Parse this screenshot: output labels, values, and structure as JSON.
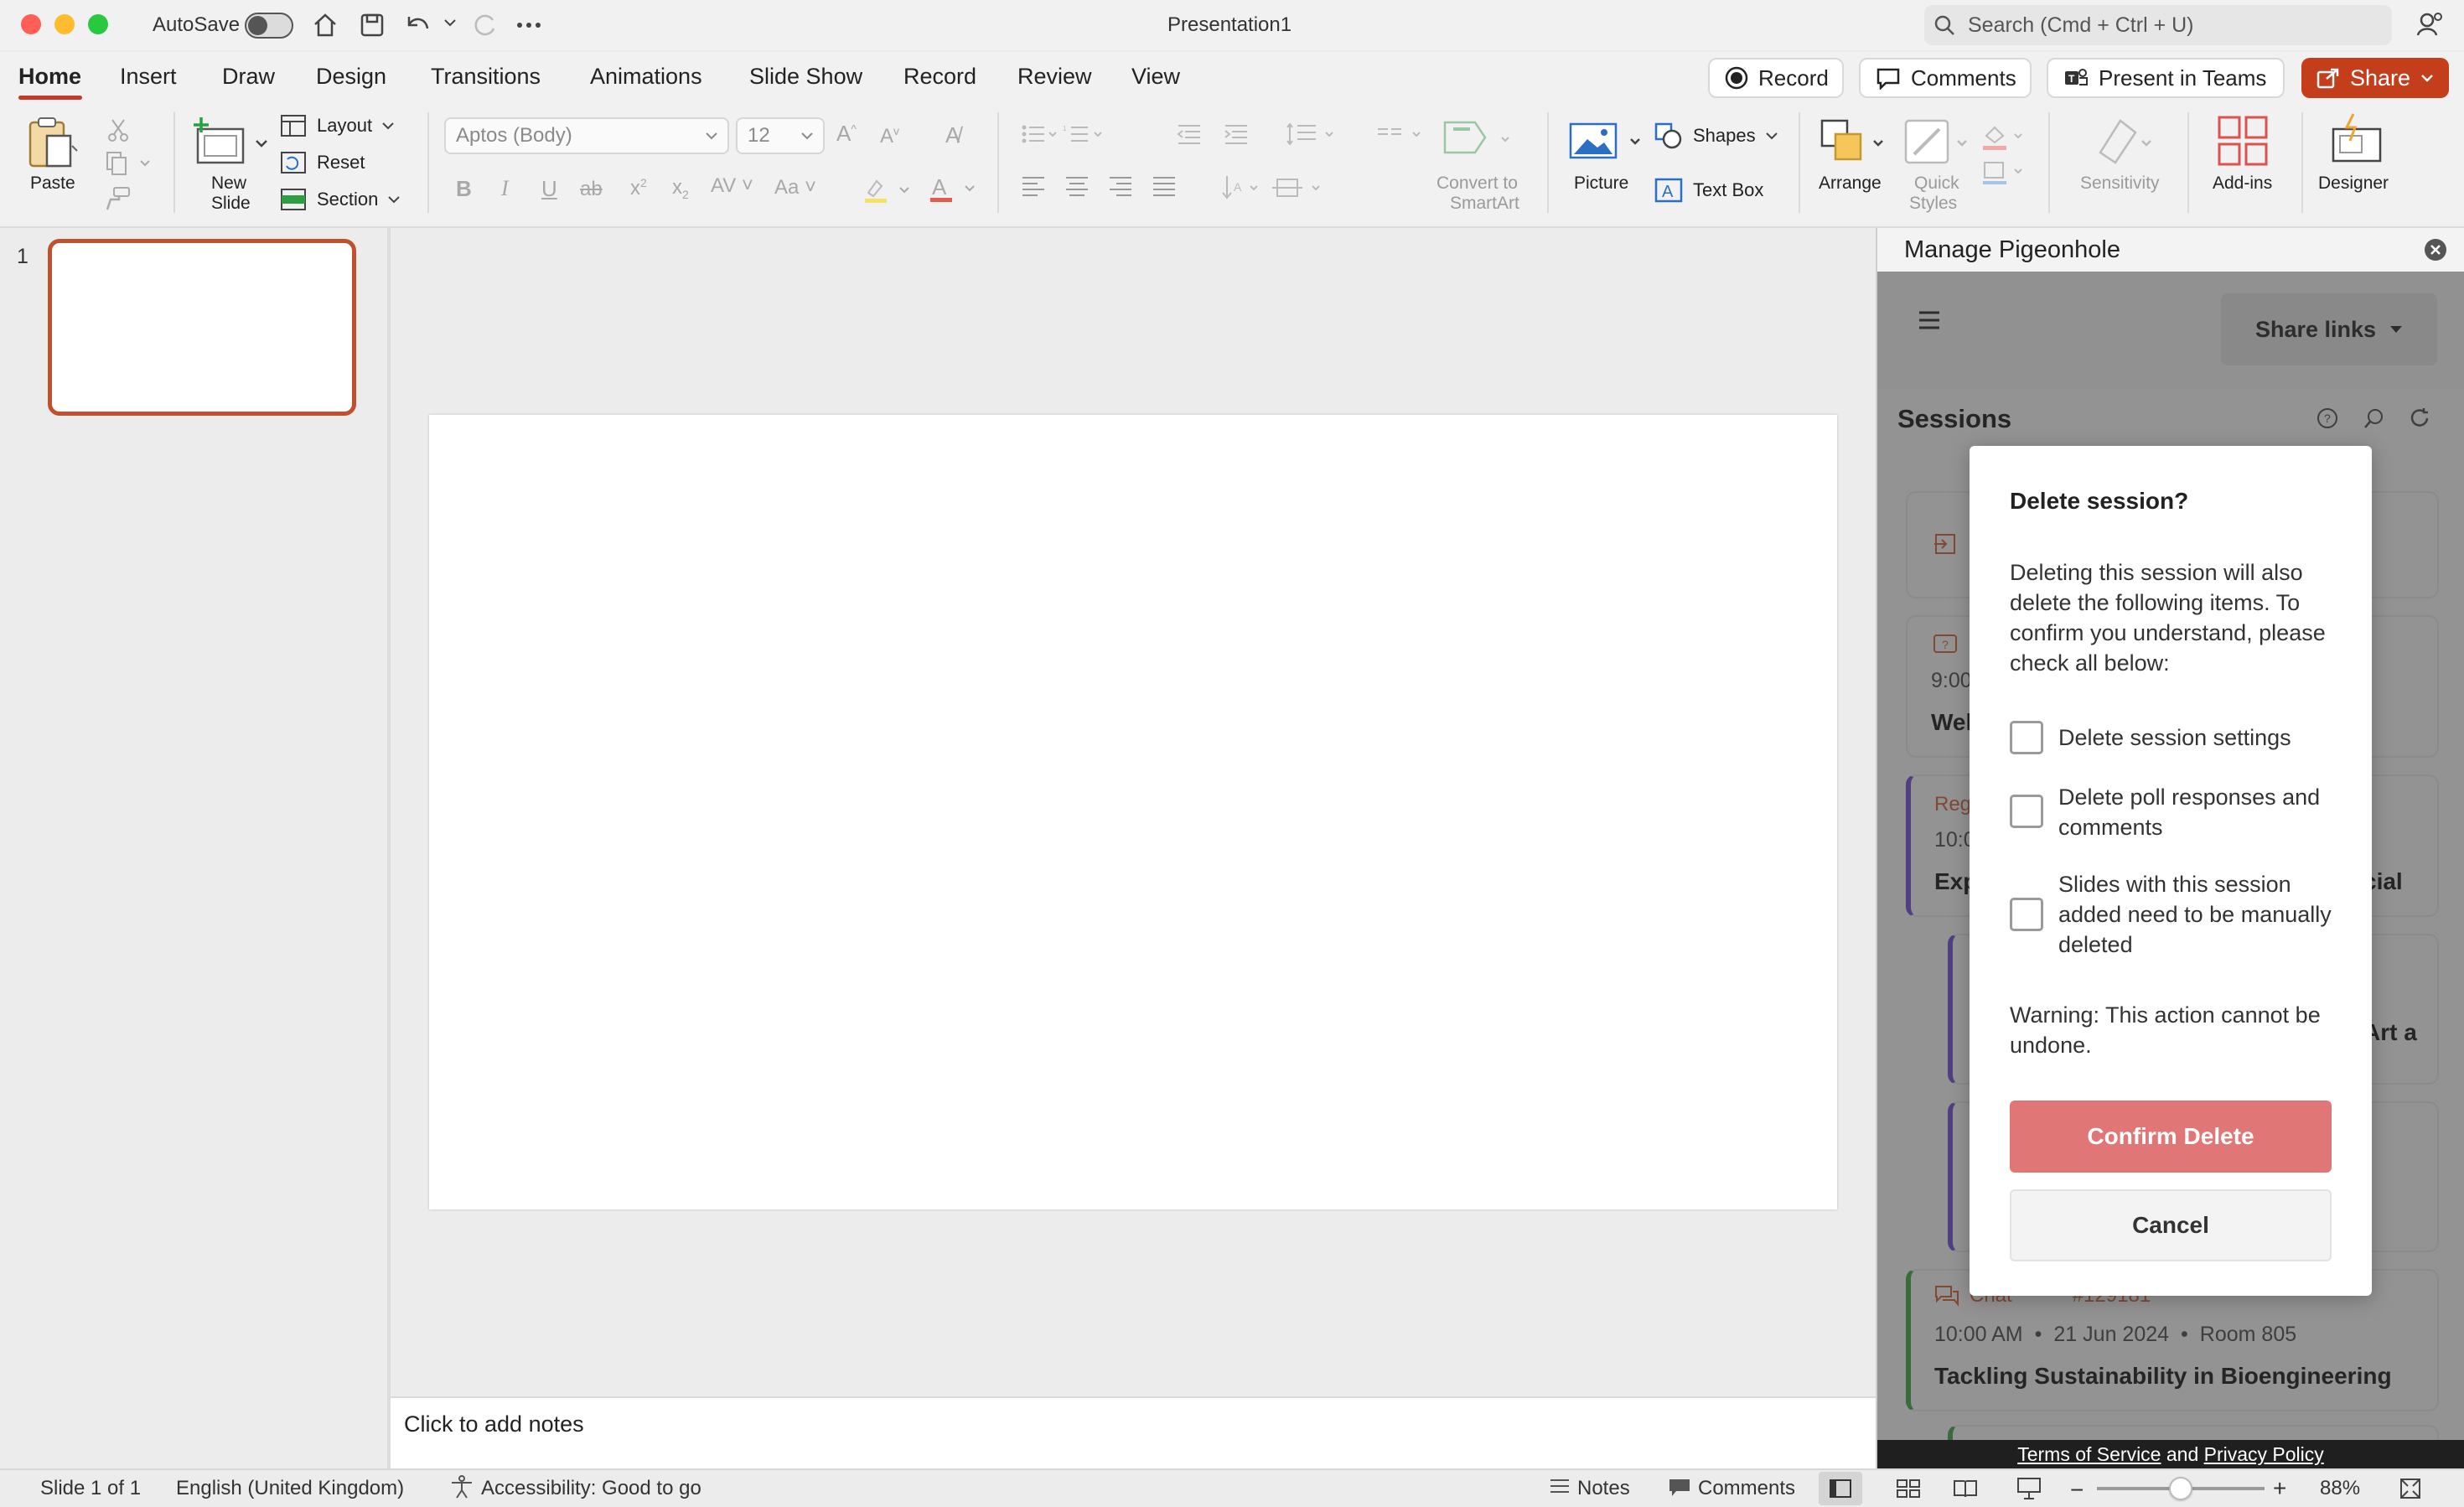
{
  "window": {
    "title": "Presentation1",
    "autosave_label": "AutoSave",
    "search_placeholder": "Search (Cmd + Ctrl + U)"
  },
  "tabs": [
    "Home",
    "Insert",
    "Draw",
    "Design",
    "Transitions",
    "Animations",
    "Slide Show",
    "Record",
    "Review",
    "View"
  ],
  "active_tab": "Home",
  "header_buttons": {
    "record": "Record",
    "comments": "Comments",
    "present_teams": "Present in Teams",
    "share": "Share"
  },
  "ribbon": {
    "paste": "Paste",
    "new_slide_1": "New",
    "new_slide_2": "Slide",
    "layout": "Layout",
    "reset": "Reset",
    "section": "Section",
    "font_name": "Aptos (Body)",
    "font_size": "12",
    "convert_1": "Convert to",
    "convert_2": "SmartArt",
    "picture": "Picture",
    "shapes": "Shapes",
    "text_box": "Text Box",
    "arrange": "Arrange",
    "quick_styles_1": "Quick",
    "quick_styles_2": "Styles",
    "sensitivity": "Sensitivity",
    "addins": "Add-ins",
    "designer": "Designer"
  },
  "slides_panel": {
    "slide_number": "1"
  },
  "notes_placeholder": "Click to add notes",
  "status_bar": {
    "slide_count": "Slide 1 of 1",
    "language": "English (United Kingdom)",
    "accessibility": "Accessibility: Good to go",
    "notes": "Notes",
    "comments": "Comments",
    "zoom": "88%",
    "zoom_level": 0.5
  },
  "side_panel": {
    "title": "Manage Pigeonhole",
    "share_links": "Share links",
    "sessions_heading": "Sessions",
    "partial_texts": [
      "9:00",
      "Wel",
      "Reg",
      "10:0",
      "Exp",
      "cial",
      "Art a",
      "Chat",
      "#129181"
    ],
    "visible_session": {
      "time": "10:00 AM",
      "date": "21 Jun 2024",
      "room": "Room 805",
      "name": "Tackling Sustainability in Bioengineering"
    },
    "legal": {
      "terms": "Terms of Service",
      "and": " and ",
      "privacy": "Privacy Policy"
    }
  },
  "dialog": {
    "title": "Delete session?",
    "body": "Deleting this session will also delete the following items. To confirm you understand, please check all below:",
    "checkboxes": [
      {
        "label": "Delete session settings",
        "checked": false
      },
      {
        "label": "Delete poll responses and comments",
        "checked": false
      },
      {
        "label": "Slides with this session added need to be manually deleted",
        "checked": false
      }
    ],
    "warning": "Warning: This action cannot be undone.",
    "confirm": "Confirm Delete",
    "cancel": "Cancel"
  },
  "colors": {
    "accent": "#c43e1c",
    "confirm": "#e07676",
    "thumb_border": "#c0502e"
  }
}
